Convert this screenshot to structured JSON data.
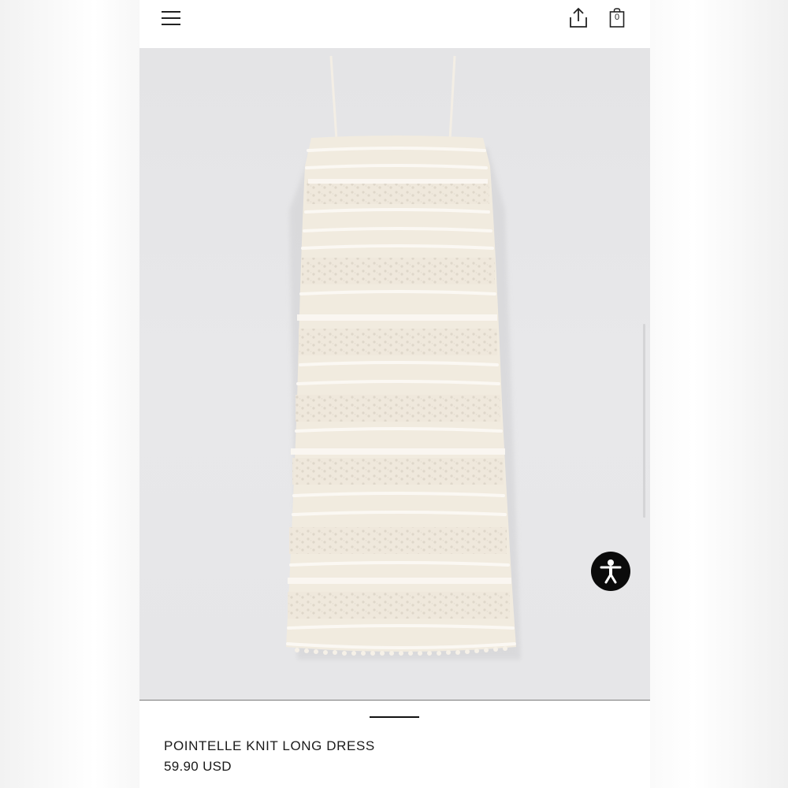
{
  "header": {
    "menu_icon": "hamburger-menu-icon",
    "share_icon": "share-upload-icon",
    "bag_icon": "shopping-bag-icon",
    "bag_count": "0"
  },
  "product": {
    "name": "POINTELLE KNIT LONG DRESS",
    "price": "59.90 USD",
    "image_subject": "cream pointelle knit slip dress"
  },
  "gallery": {
    "pager_count": 1,
    "active_index": 0
  },
  "accessibility": {
    "icon": "accessibility-person-icon"
  },
  "colors": {
    "dress": "#f1ebdf",
    "image_background": "#e6e6e8",
    "accent_dark": "#0b0b0b"
  }
}
